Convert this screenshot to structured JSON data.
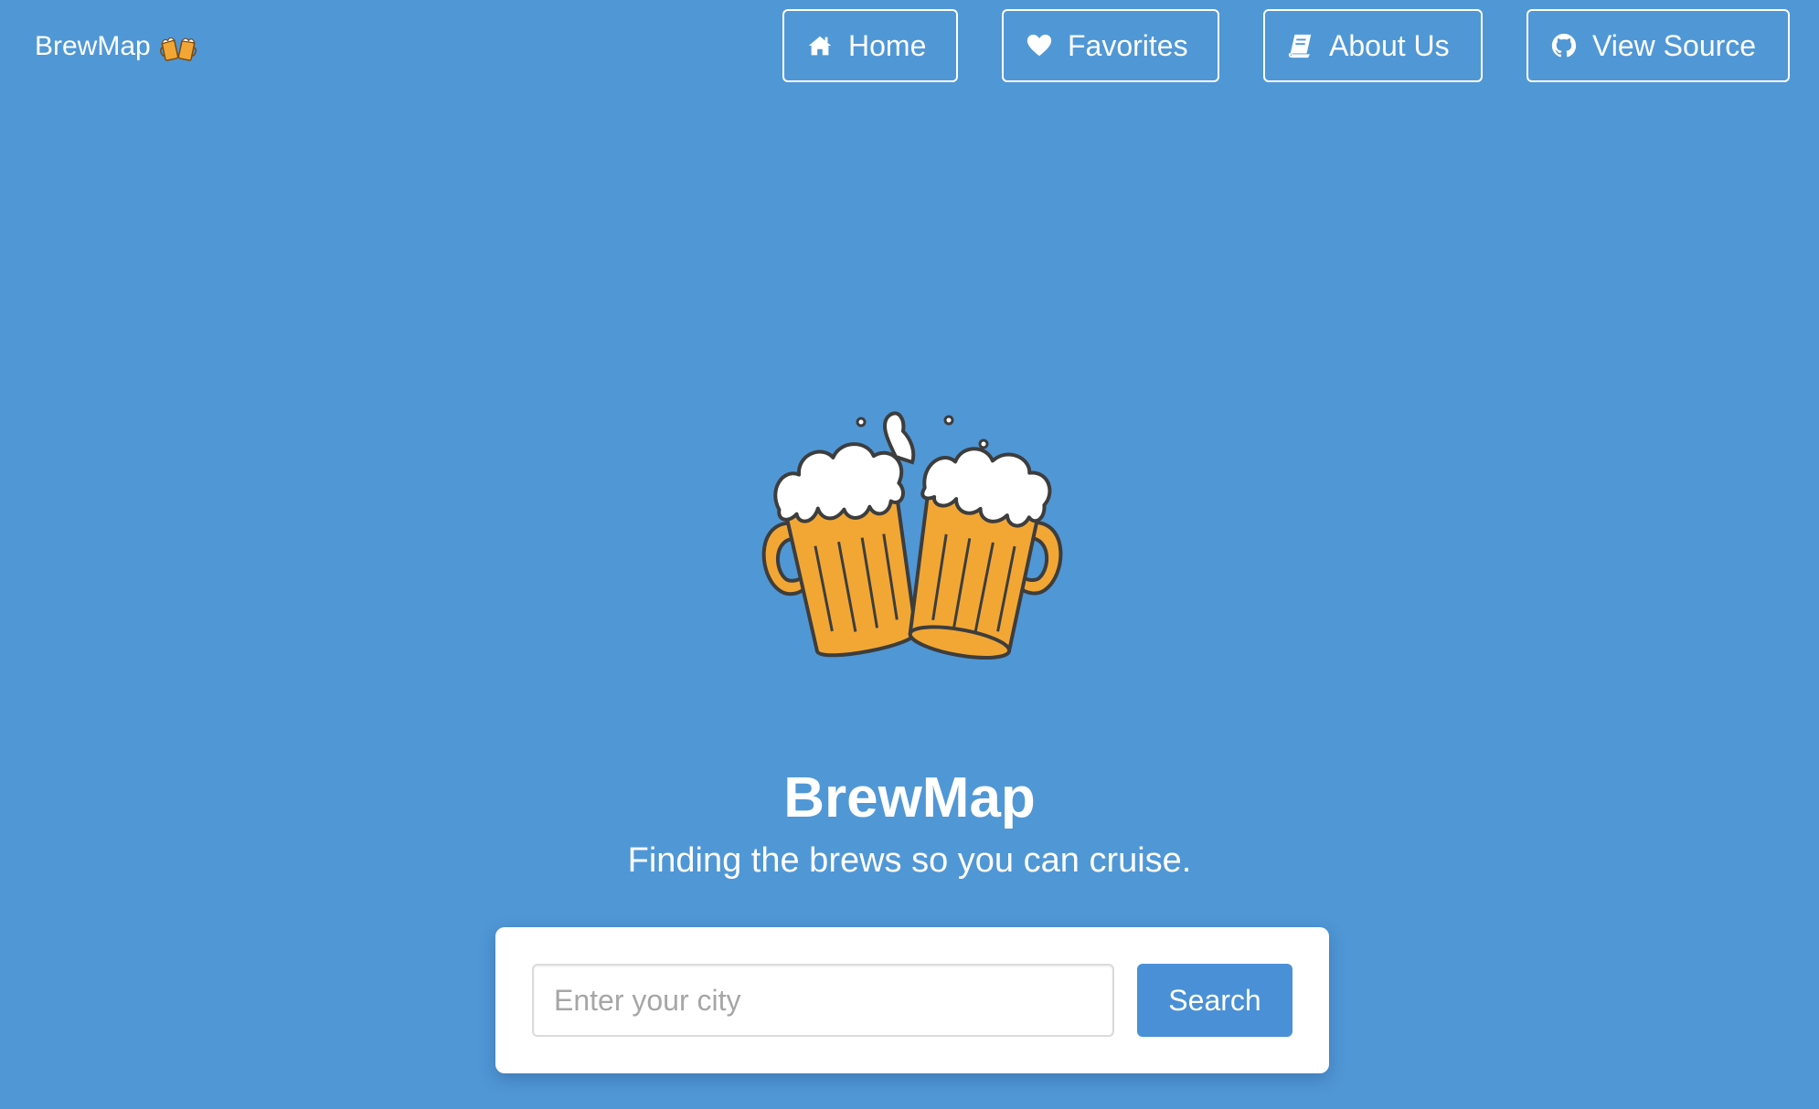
{
  "nav": {
    "brand": "BrewMap",
    "brand_icon": "clinking-beer-mugs-icon",
    "items": [
      {
        "label": "Home",
        "icon": "home-icon"
      },
      {
        "label": "Favorites",
        "icon": "heart-icon"
      },
      {
        "label": "About Us",
        "icon": "book-icon"
      },
      {
        "label": "View Source",
        "icon": "github-icon"
      }
    ]
  },
  "hero": {
    "image": "clinking-beer-mugs-illustration",
    "title": "BrewMap",
    "subtitle": "Finding the brews so you can cruise."
  },
  "search": {
    "placeholder": "Enter your city",
    "value": "",
    "button_label": "Search"
  },
  "colors": {
    "background": "#5097d6",
    "primary_button": "#4a90d6",
    "beer": "#f2a735",
    "foam": "#ffffff",
    "outline": "#3d3d3d"
  }
}
